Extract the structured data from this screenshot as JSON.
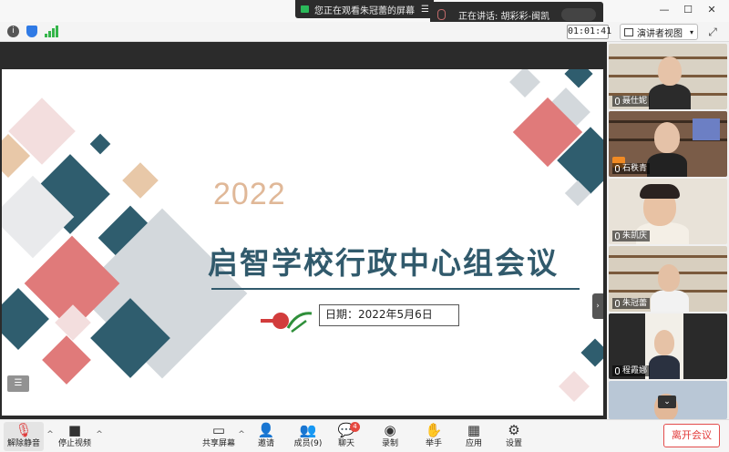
{
  "window": {
    "sharing_indicator": "您正在观看朱冠蕾的屏幕",
    "sharing_menu": "☰",
    "speaking_label": "正在讲话: 胡彩彩-闽凯",
    "controls": {
      "minimize": "—",
      "maximize": "☐",
      "close": "✕"
    }
  },
  "info_bar": {
    "info_icon": "i",
    "timer": "01:01:41",
    "view_button_label": "演讲者视图",
    "view_caret": "▾",
    "fullscreen_icon": "⤢"
  },
  "slide": {
    "year": "2022",
    "title": "启智学校行政中心组会议",
    "date": "日期：2022年5月6日",
    "prev_icon": "☰",
    "collapse_icon": "›"
  },
  "gallery": {
    "participants": [
      {
        "name": "聂仕妮"
      },
      {
        "name": "石秩青"
      },
      {
        "name": "朱凯庆"
      },
      {
        "name": "朱冠蕾"
      },
      {
        "name": "程霞娜"
      },
      {
        "name": ""
      }
    ],
    "scroll_icon": "⌄"
  },
  "toolbar": {
    "unmute": "解除静音",
    "stop_video": "停止视频",
    "share": "共享屏幕",
    "invite": "邀请",
    "participants": "成员(9)",
    "chat": "聊天",
    "chat_badge": "4",
    "record": "录制",
    "raise_hand": "举手",
    "apps": "应用",
    "settings": "设置",
    "leave": "离开会议",
    "more_arrow": "^"
  },
  "colors": {
    "slide_dark_teal": "#2f5d6e",
    "slide_coral": "#e07a7a",
    "slide_gray": "#c9d0d6",
    "slide_pink": "#f3dede",
    "slide_tan": "#e8c8a8",
    "title": "#315a6c",
    "leave": "#e34c4c"
  }
}
